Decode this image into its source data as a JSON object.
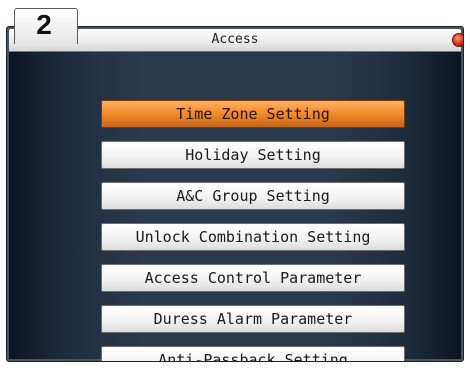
{
  "step_number": "2",
  "window": {
    "title": "Access"
  },
  "menu": {
    "items": [
      {
        "label": "Time Zone Setting",
        "selected": true
      },
      {
        "label": "Holiday Setting",
        "selected": false
      },
      {
        "label": "A&C Group Setting",
        "selected": false
      },
      {
        "label": "Unlock Combination Setting",
        "selected": false
      },
      {
        "label": "Access Control Parameter",
        "selected": false
      },
      {
        "label": "Duress Alarm Parameter",
        "selected": false
      },
      {
        "label": "Anti-Passback Setting",
        "selected": false
      }
    ]
  },
  "colors": {
    "selected_item": "#f08a2a",
    "background": "#2a3b4d",
    "close_button": "#e03a1c"
  },
  "icons": {
    "close": "close-icon"
  }
}
